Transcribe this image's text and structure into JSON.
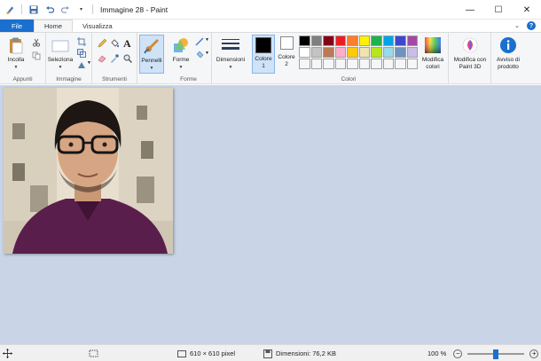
{
  "window": {
    "title": "Immagine 28 - Paint",
    "minimize_glyph": "—",
    "maximize_glyph": "☐",
    "close_glyph": "✕"
  },
  "tabs": [
    {
      "label": "File"
    },
    {
      "label": "Home"
    },
    {
      "label": "Visualizza"
    }
  ],
  "ribbon": {
    "groups": {
      "clipboard": "Appunti",
      "image": "Immagine",
      "tools": "Strumenti",
      "shapes": "Forme",
      "colors": "Colori"
    },
    "paste": "Incolla",
    "select": "Seleziona",
    "brushes": "Pennelli",
    "shapes": "Forme",
    "size": "Dimensioni",
    "color1_line1": "Colore",
    "color1_line2": "1",
    "color2_line1": "Colore",
    "color2_line2": "2",
    "edit_colors_line1": "Modifica",
    "edit_colors_line2": "colori",
    "paint3d_line1": "Modifica con",
    "paint3d_line2": "Paint 3D",
    "alert_line1": "Avviso di",
    "alert_line2": "prodotto"
  },
  "palette": {
    "row1": [
      "#000000",
      "#7f7f7f",
      "#880015",
      "#ed1c24",
      "#ff7f27",
      "#fff200",
      "#22b14c",
      "#00a2e8",
      "#3f48cc",
      "#a349a4"
    ],
    "row2": [
      "#ffffff",
      "#c3c3c3",
      "#b97a57",
      "#ffaec9",
      "#ffc90e",
      "#efe4b0",
      "#b5e61d",
      "#99d9ea",
      "#7092be",
      "#c8bfe7"
    ],
    "row3_count_label": ""
  },
  "status": {
    "dimensions_image": "610 × 610 pixel",
    "file_size": "Dimensioni: 76,2 KB",
    "zoom": "100 %",
    "zoom_level": 100
  },
  "colors": {
    "accent": "#1a6fcf",
    "workspace": "#c9d4e6",
    "ribbon": "#f5f6f7"
  }
}
